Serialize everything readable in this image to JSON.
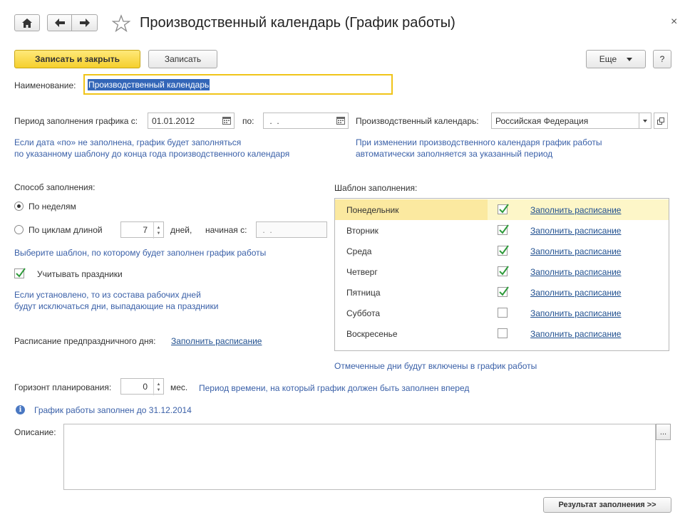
{
  "window": {
    "title": "Производственный календарь (График работы)",
    "close_glyph": "×"
  },
  "toolbar": {
    "save_close": "Записать и закрыть",
    "save": "Записать",
    "more": "Еще",
    "help": "?"
  },
  "name": {
    "label": "Наименование:",
    "value": "Производственный календарь"
  },
  "period": {
    "label": "Период заполнения графика с:",
    "from": "01.01.2012",
    "to_label": "по:",
    "to": " .  .",
    "hint_line1": "Если дата «по» не заполнена, график будет заполняться",
    "hint_line2": "по указанному шаблону до конца года производственного календаря"
  },
  "calendar": {
    "label": "Производственный календарь:",
    "value": "Российская Федерация",
    "hint_line1": "При изменении производственного календаря график работы",
    "hint_line2": "автоматически заполняется за указанный период"
  },
  "fill_method": {
    "label": "Способ заполнения:",
    "by_weeks": "По неделям",
    "by_cycles": "По циклам длиной",
    "cycle_length": "7",
    "days_label": "дней,",
    "starting_label": "начиная с:",
    "starting_value": " .  .",
    "hint": "Выберите шаблон, по которому будет заполнен график работы",
    "holidays_label": "Учитывать праздники",
    "holidays_hint_line1": "Если установлено, то из состава рабочих дней",
    "holidays_hint_line2": "будут исключаться дни, выпадающие на праздники",
    "preholiday_label": "Расписание предпраздничного дня:",
    "preholiday_link": "Заполнить расписание"
  },
  "template": {
    "label": "Шаблон заполнения:",
    "days": [
      {
        "name": "Понедельник",
        "checked": true,
        "link": "Заполнить расписание"
      },
      {
        "name": "Вторник",
        "checked": true,
        "link": "Заполнить расписание"
      },
      {
        "name": "Среда",
        "checked": true,
        "link": "Заполнить расписание"
      },
      {
        "name": "Четверг",
        "checked": true,
        "link": "Заполнить расписание"
      },
      {
        "name": "Пятница",
        "checked": true,
        "link": "Заполнить расписание"
      },
      {
        "name": "Суббота",
        "checked": false,
        "link": "Заполнить расписание"
      },
      {
        "name": "Воскресенье",
        "checked": false,
        "link": "Заполнить расписание"
      }
    ],
    "hint": "Отмеченные дни будут включены в график работы"
  },
  "horizon": {
    "label": "Горизонт планирования:",
    "value": "0",
    "unit": "мес.",
    "hint": "Период времени, на который график должен быть заполнен вперед"
  },
  "info": {
    "text": "График работы заполнен до 31.12.2014"
  },
  "description": {
    "label": "Описание:",
    "value": "",
    "more": "..."
  },
  "result_button": "Результат заполнения >>",
  "colors": {
    "accent_yellow": "#f5cf2c",
    "hint_blue": "#3a60a8",
    "selected_row": "#fdf6c8",
    "check_green": "#2e9a3a"
  }
}
